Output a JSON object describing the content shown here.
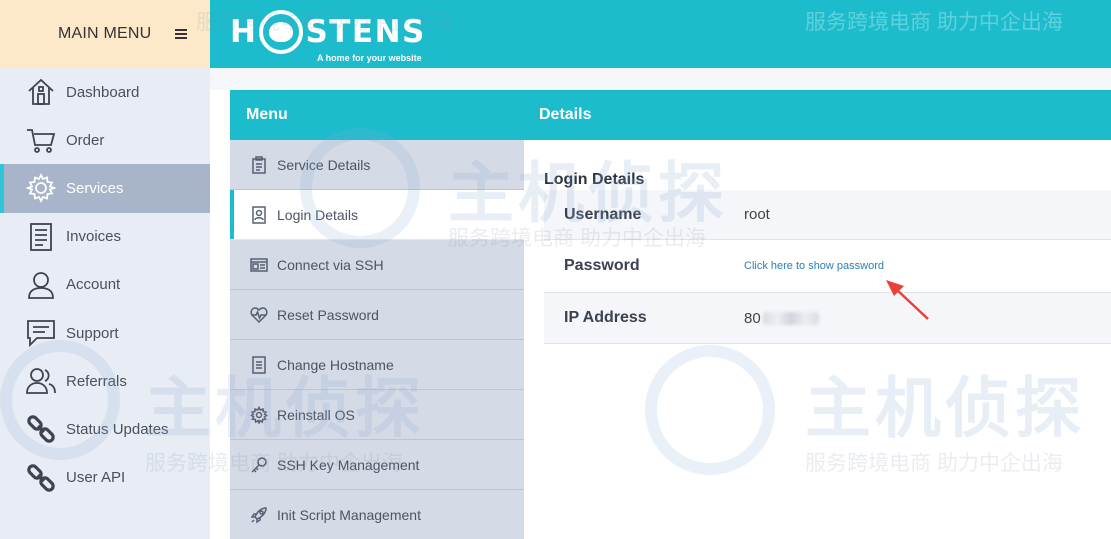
{
  "sidebar": {
    "main_menu_label": "MAIN MENU",
    "items": [
      {
        "label": "Dashboard",
        "icon": "home-icon"
      },
      {
        "label": "Order",
        "icon": "cart-icon"
      },
      {
        "label": "Services",
        "icon": "gear-icon",
        "active": true
      },
      {
        "label": "Invoices",
        "icon": "document-icon"
      },
      {
        "label": "Account",
        "icon": "user-icon"
      },
      {
        "label": "Support",
        "icon": "chat-icon"
      },
      {
        "label": "Referrals",
        "icon": "users-icon"
      },
      {
        "label": "Status Updates",
        "icon": "link-icon"
      },
      {
        "label": "User API",
        "icon": "link-icon"
      }
    ]
  },
  "header": {
    "logo_left": "H",
    "logo_right": "STENS",
    "tagline": "A home for your website"
  },
  "panel": {
    "menu_title": "Menu",
    "details_title": "Details"
  },
  "submenu": {
    "items": [
      {
        "label": "Service Details",
        "icon": "clipboard-icon"
      },
      {
        "label": "Login Details",
        "icon": "id-card-icon",
        "active": true
      },
      {
        "label": "Connect via SSH",
        "icon": "terminal-icon"
      },
      {
        "label": "Reset Password",
        "icon": "heartbeat-icon"
      },
      {
        "label": "Change Hostname",
        "icon": "file-icon"
      },
      {
        "label": "Reinstall OS",
        "icon": "gear-icon"
      },
      {
        "label": "SSH Key Management",
        "icon": "key-icon"
      },
      {
        "label": "Init Script Management",
        "icon": "rocket-icon"
      }
    ]
  },
  "details": {
    "section_title": "Login Details",
    "username_label": "Username",
    "username_value": "root",
    "password_label": "Password",
    "password_link": "Click here to show password",
    "ip_label": "IP Address",
    "ip_value": "80"
  },
  "watermarks": {
    "slogan": "服务跨境电商 助力中企出海",
    "brand": "主机侦探"
  },
  "colors": {
    "accent": "#1cbccd",
    "sidebar_bg": "#e8ecf4",
    "sidebar_active": "#a7b4c9",
    "submenu_bg": "#d4dae6",
    "main_menu_bg": "#fde9c9",
    "annotation_arrow": "#e8413a"
  }
}
